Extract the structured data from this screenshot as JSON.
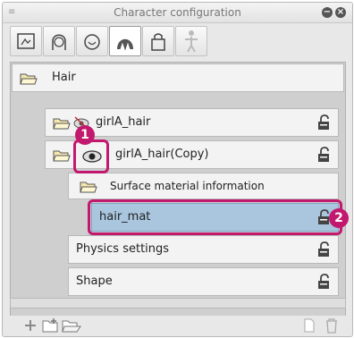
{
  "panel": {
    "title": "Character configuration"
  },
  "tabs": [
    {
      "name": "face-tab",
      "active": false
    },
    {
      "name": "hair-tab",
      "active": false
    },
    {
      "name": "head-tab",
      "active": false
    },
    {
      "name": "hair-parts-tab",
      "active": true
    },
    {
      "name": "accessory-tab",
      "active": false
    },
    {
      "name": "body-tab",
      "active": false
    }
  ],
  "tree": {
    "root": "Hair",
    "items": [
      {
        "label": "girlA_hair"
      },
      {
        "label": "girlA_hair(Copy)"
      },
      {
        "label": "Surface material information"
      },
      {
        "label": "hair_mat"
      },
      {
        "label": "Physics settings"
      },
      {
        "label": "Shape"
      }
    ]
  },
  "annotations": {
    "step1": "1",
    "step2": "2"
  },
  "colors": {
    "accent": "#c2186e",
    "selected_row": "#a9c6de"
  }
}
